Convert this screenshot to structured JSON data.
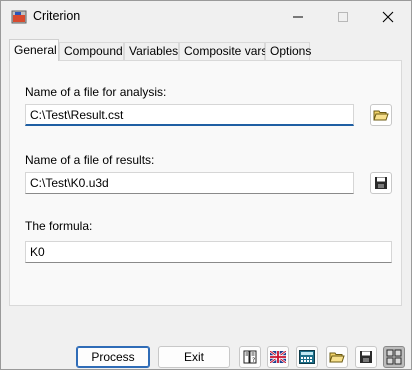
{
  "window": {
    "title": "Criterion"
  },
  "tabs": [
    {
      "label": "General"
    },
    {
      "label": "Compound"
    },
    {
      "label": "Variables"
    },
    {
      "label": "Composite vars"
    },
    {
      "label": "Options"
    }
  ],
  "general": {
    "analysis_file": {
      "label": "Name of a file for analysis:",
      "value": "C:\\Test\\Result.cst"
    },
    "results_file": {
      "label": "Name of a file of results:",
      "value": "C:\\Test\\K0.u3d"
    },
    "formula": {
      "label": "The formula:",
      "value": "K0"
    }
  },
  "buttons": {
    "process": "Process",
    "exit": "Exit"
  },
  "colors": {
    "focus_accent": "#1f5fa3",
    "primary_border": "#2f6cb7"
  }
}
